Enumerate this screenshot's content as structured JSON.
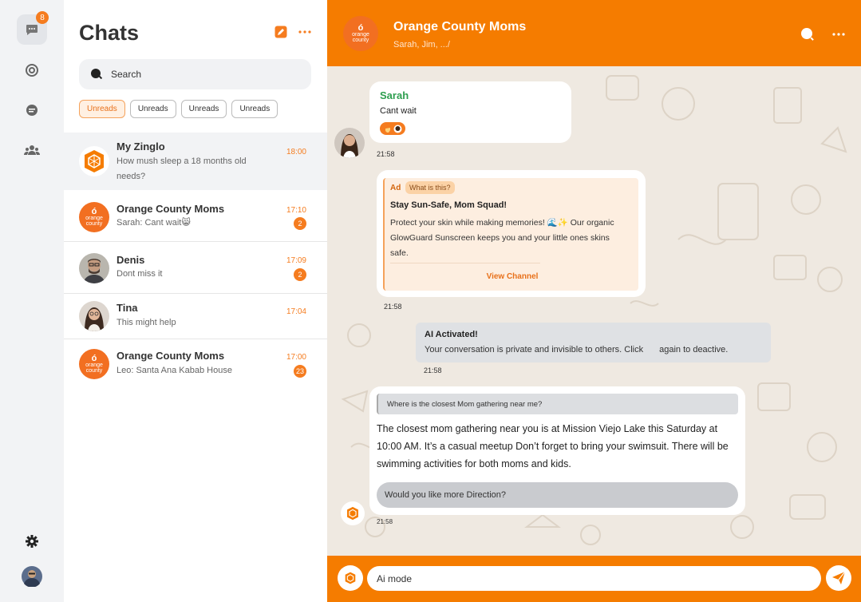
{
  "rail": {
    "chats_badge": "8",
    "icons": [
      "chat-bubble-icon",
      "status-icon",
      "message-icon",
      "community-icon",
      "settings-icon",
      "avatar"
    ]
  },
  "list": {
    "title": "Chats",
    "search_placeholder": "Search",
    "filters": [
      "Unreads",
      "Unreads",
      "Unreads",
      "Unreads"
    ],
    "items": [
      {
        "name": "My Zinglo",
        "preview": "How mush sleep a 18 months old needs?",
        "time": "18:00",
        "count": ""
      },
      {
        "name": "Orange County Moms",
        "preview": "Sarah: Cant wait😸",
        "time": "17:10",
        "count": "2"
      },
      {
        "name": "Denis",
        "preview": "Dont miss it",
        "time": "17:09",
        "count": "2"
      },
      {
        "name": "Tina",
        "preview": "This might help",
        "time": "17:04",
        "count": ""
      },
      {
        "name": "Orange County Moms",
        "preview": "Leo: Santa Ana Kabab House",
        "time": "17:00",
        "count": "23"
      }
    ]
  },
  "logo": {
    "mark": "ó",
    "line1": "orange",
    "line2": "county"
  },
  "header": {
    "title": "Orange County Moms",
    "subtitle": "Sarah, Jim, .../"
  },
  "messages": {
    "sarah": {
      "sender": "Sarah",
      "text": "Cant wait",
      "time": "21:58"
    },
    "ad": {
      "label": "Ad",
      "what": "What is this?",
      "title": "Stay Sun-Safe, Mom Squad!",
      "body": "Protect your skin while making memories! 🌊✨ Our organic GlowGuard Sunscreen keeps you and your little ones skins safe.",
      "cta": "View Channel",
      "time": "21:58"
    },
    "ai_notice": {
      "title": "AI Activated!",
      "text_before": "Your conversation is private and invisible to others. Click",
      "text_after": "again to deactive.",
      "time": "21:58"
    },
    "ai_reply": {
      "question": "Where is the closest Mom gathering near me?",
      "answer": "The closest mom gathering near you is at Mission Viejo Lake this Saturday at 10:00 AM. It’s a casual meetup Don’t forget to bring your swimsuit. There will be swimming activities for both moms and kids.",
      "followup": "Would you like more Direction?",
      "time": "21:58"
    }
  },
  "composer": {
    "value": "Ai mode"
  },
  "colors": {
    "brand": "#f57c00",
    "accent": "#f57c1f",
    "sarah_name": "#2e9e4f"
  }
}
